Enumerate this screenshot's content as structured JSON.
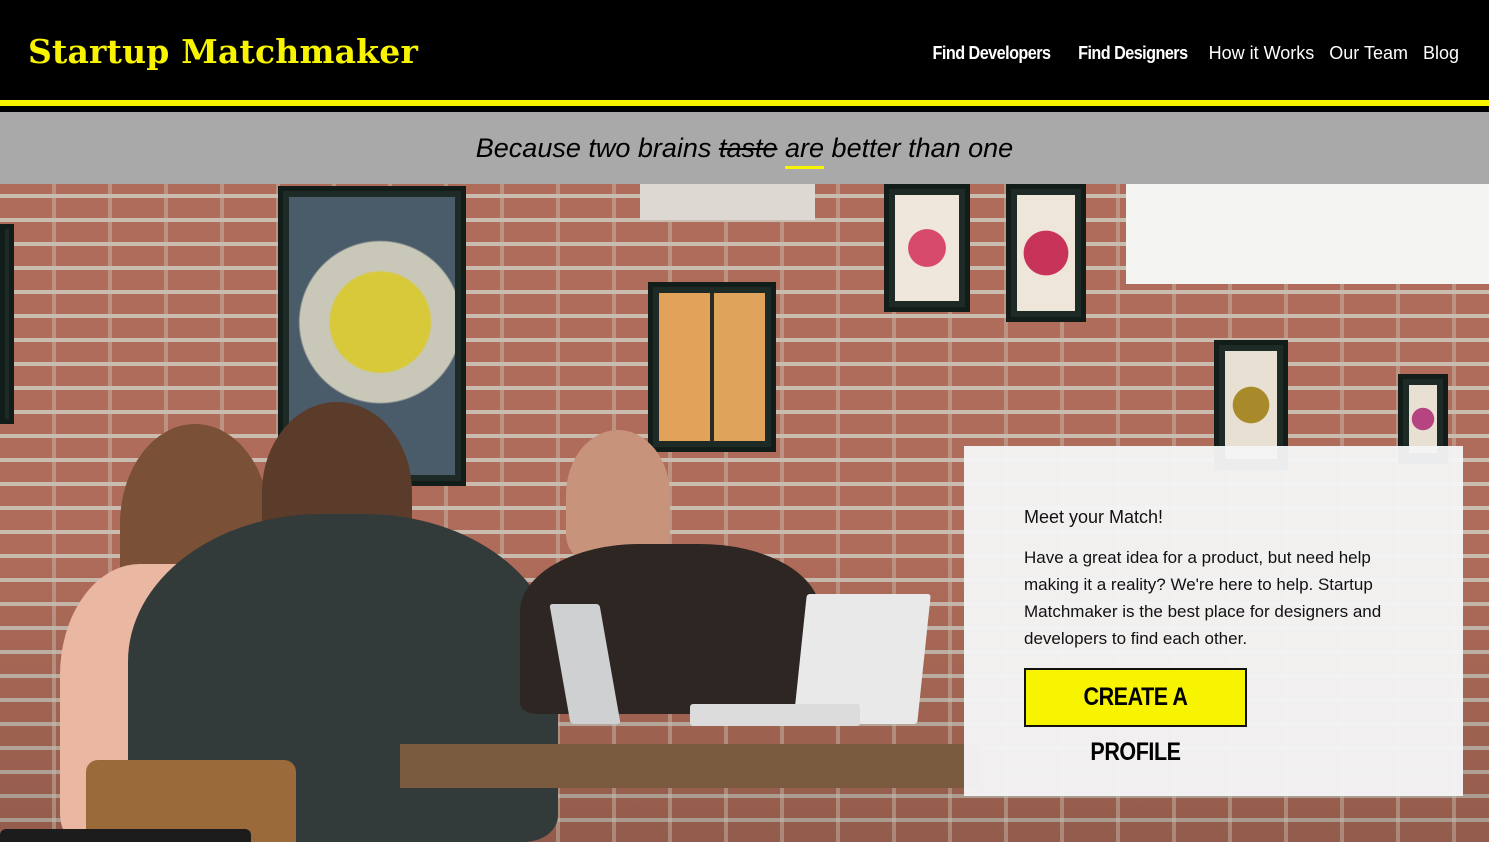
{
  "brand": {
    "name": "Startup Matchmaker",
    "color": "#f8f400"
  },
  "nav": {
    "items": [
      {
        "label": "Find Developers"
      },
      {
        "label": "Find Designers"
      },
      {
        "label": "How it Works"
      },
      {
        "label": "Our Team"
      },
      {
        "label": "Blog"
      }
    ]
  },
  "tagline": {
    "before": "Because two brains",
    "struck": "taste",
    "highlight": "are",
    "after": "better than one"
  },
  "hero": {
    "image": "people-working-at-cafe-with-brick-wall"
  },
  "card": {
    "title": "Meet your Match!",
    "body": "Have a great idea for a product, but need help making it a reality? We're here to help. Startup Matchmaker is the best place for designers and developers to find each other.",
    "cta_label": "CREATE A PROFILE"
  },
  "colors": {
    "accent": "#f8f400",
    "header_bg": "#000000",
    "tagline_bg": "#a9a9a9"
  }
}
